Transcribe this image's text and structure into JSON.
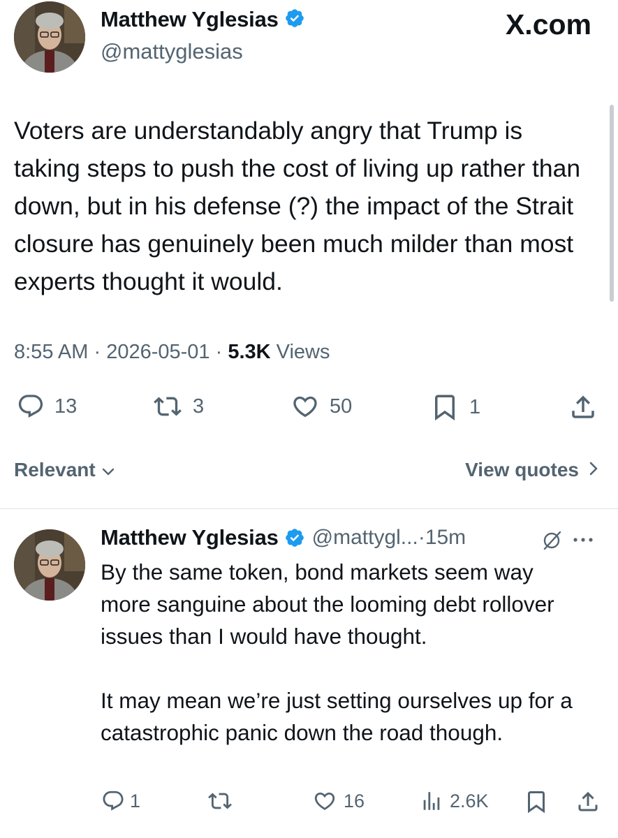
{
  "main_tweet": {
    "author_name": "Matthew Yglesias",
    "handle": "@mattyglesias",
    "watermark": "X.com",
    "text": "Voters are understandably angry that Trump is taking steps to push the cost of living up rather than down, but in his defense (?) the impact of the Strait closure has genuinely been much milder than most experts thought it would.",
    "time": "8:55 AM",
    "date": "2026-05-01",
    "views_count": "5.3K",
    "views_label": "Views",
    "replies": "13",
    "reposts": "3",
    "likes": "50",
    "bookmarks": "1"
  },
  "filter": {
    "sort_label": "Relevant",
    "view_quotes_label": "View quotes"
  },
  "reply": {
    "author_name": "Matthew Yglesias",
    "handle": "@mattygl...",
    "time_ago": "15m",
    "paragraph1": "By the same token, bond markets seem way more sanguine about the looming debt rollover issues than I would have thought.",
    "paragraph2": "It may mean we’re just setting ourselves up for a catastrophic panic down the road though.",
    "replies": "1",
    "reposts": "",
    "likes": "16",
    "views": "2.6K"
  },
  "colors": {
    "verified_blue": "#1d9bf0",
    "text": "#0f1419",
    "secondary": "#536471"
  }
}
